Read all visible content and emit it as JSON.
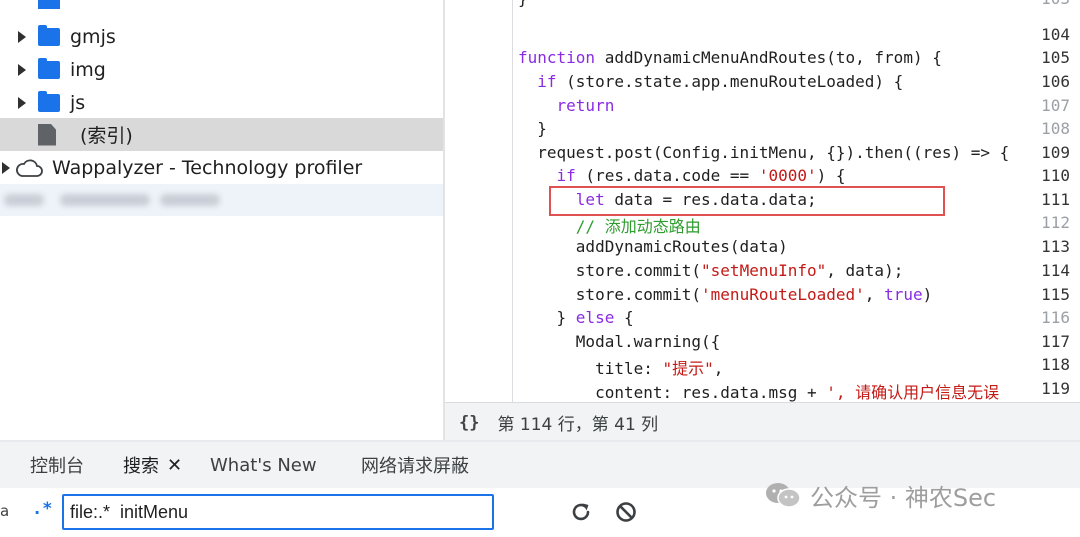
{
  "tree": {
    "items": [
      {
        "label": "gmjs",
        "type": "folder"
      },
      {
        "label": "img",
        "type": "folder"
      },
      {
        "label": "js",
        "type": "folder"
      },
      {
        "label": "(索引)",
        "type": "file"
      },
      {
        "label": "Wappalyzer - Technology profiler",
        "type": "extension"
      }
    ]
  },
  "editor": {
    "lines": [
      {
        "n": "103",
        "dim": true
      },
      {
        "n": "104",
        "dim": false
      },
      {
        "n": "105",
        "dim": false
      },
      {
        "n": "106",
        "dim": false
      },
      {
        "n": "107",
        "dim": true
      },
      {
        "n": "108",
        "dim": true
      },
      {
        "n": "109",
        "dim": false
      },
      {
        "n": "110",
        "dim": false
      },
      {
        "n": "111",
        "dim": false
      },
      {
        "n": "112",
        "dim": true
      },
      {
        "n": "113",
        "dim": false
      },
      {
        "n": "114",
        "dim": false
      },
      {
        "n": "115",
        "dim": false
      },
      {
        "n": "116",
        "dim": true
      },
      {
        "n": "117",
        "dim": false
      },
      {
        "n": "118",
        "dim": false
      },
      {
        "n": "119",
        "dim": false
      }
    ],
    "code": {
      "l103": "}",
      "l105a": "function",
      "l105b": " addDynamicMenuAndRoutes(to, from) {",
      "l106a": "  if",
      "l106b": " (store.state.app.menuRouteLoaded) {",
      "l107": "    return",
      "l108": "  }",
      "l109": "  request.post(Config.initMenu, {}).then((res) => {",
      "l110a": "    if",
      "l110b": " (res.data.code == ",
      "l110c": "'0000'",
      "l110d": ") {",
      "l111a": "      let",
      "l111b": " data = res.data.data;",
      "l112": "      // 添加动态路由",
      "l113": "      addDynamicRoutes(data)",
      "l114a": "      store.commit(",
      "l114b": "\"setMenuInfo\"",
      "l114c": ", data);",
      "l115a": "      store.commit(",
      "l115b": "'menuRouteLoaded'",
      "l115c": ", ",
      "l115d": "true",
      "l115e": ")",
      "l116a": "    } ",
      "l116b": "else",
      "l116c": " {",
      "l117": "      Modal.warning({",
      "l118a": "        title: ",
      "l118b": "\"提示\"",
      "l118c": ",",
      "l119a": "        content: res.data.msg + ",
      "l119b": "', 请确认用户信息无误"
    }
  },
  "statusbar": {
    "braces": "{}",
    "cursor": "第 114 行，第 41 列"
  },
  "drawer": {
    "tabs": [
      {
        "label": "控制台"
      },
      {
        "label": "搜索",
        "active": true,
        "close": "✕"
      },
      {
        "label": "What's New"
      },
      {
        "label": "网络请求屏蔽"
      }
    ]
  },
  "search": {
    "case_label": "a",
    "regex_label": ".*",
    "query": "file:.*  initMenu"
  },
  "watermark": {
    "text": "公众号 · 神农Sec"
  },
  "colors": {
    "accent": "#1a73e8",
    "keyword": "#8a2be2",
    "string": "#c41a16",
    "comment": "#2e9d2e",
    "highlight_box": "#e05252"
  }
}
